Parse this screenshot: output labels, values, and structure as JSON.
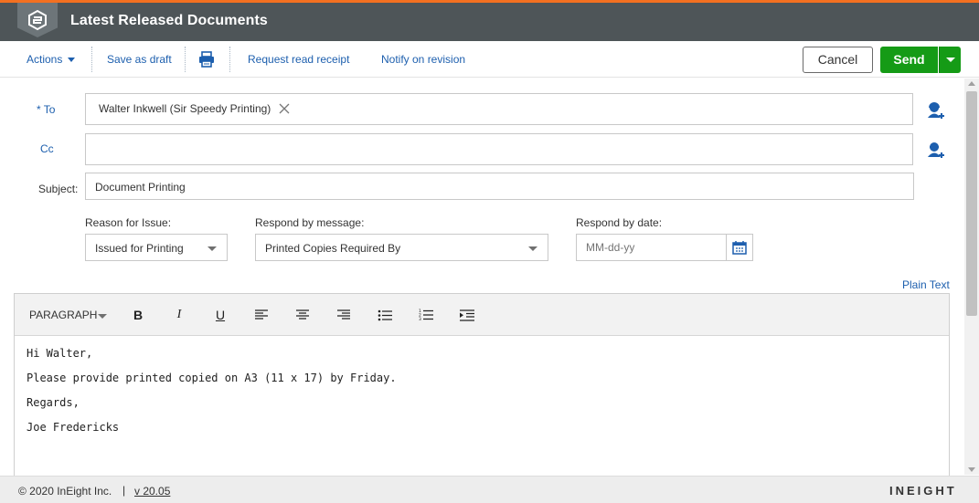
{
  "colors": {
    "accent": "#f37021",
    "header_bg": "#4e5558",
    "link": "#1d5fae",
    "send_green": "#159b16"
  },
  "header": {
    "title": "Latest Released Documents",
    "logo_icon": "ineight-logo-icon"
  },
  "toolbar": {
    "actions_label": "Actions",
    "save_draft_label": "Save as draft",
    "print_icon": "printer-icon",
    "request_receipt_label": "Request read receipt",
    "notify_label": "Notify on revision",
    "cancel_label": "Cancel",
    "send_label": "Send"
  },
  "form": {
    "to_label": "* To",
    "to_recipient": "Walter Inkwell (Sir Speedy Printing)",
    "cc_label": "Cc",
    "cc_value": "",
    "subject_label": "Subject:",
    "subject_value": "Document Printing",
    "reason_label": "Reason for Issue:",
    "reason_value": "Issued for Printing",
    "respond_msg_label": "Respond by message:",
    "respond_msg_value": "Printed Copies Required By",
    "respond_date_label": "Respond by date:",
    "respond_date_placeholder": "MM-dd-yy",
    "plain_text_label": "Plain Text"
  },
  "editor": {
    "paragraph_label": "PARAGRAPH",
    "tools": [
      "bold",
      "italic",
      "underline",
      "align-left",
      "align-center",
      "align-right",
      "bulleted-list",
      "numbered-list",
      "indent"
    ],
    "lines": [
      "Hi Walter,",
      "Please provide printed copied on A3 (11 x 17) by Friday.",
      "Regards,",
      "Joe Fredericks"
    ]
  },
  "footer": {
    "copyright": "© 2020 InEight Inc.",
    "separator": "|",
    "version": "v 20.05",
    "brand": "INEIGHT"
  }
}
